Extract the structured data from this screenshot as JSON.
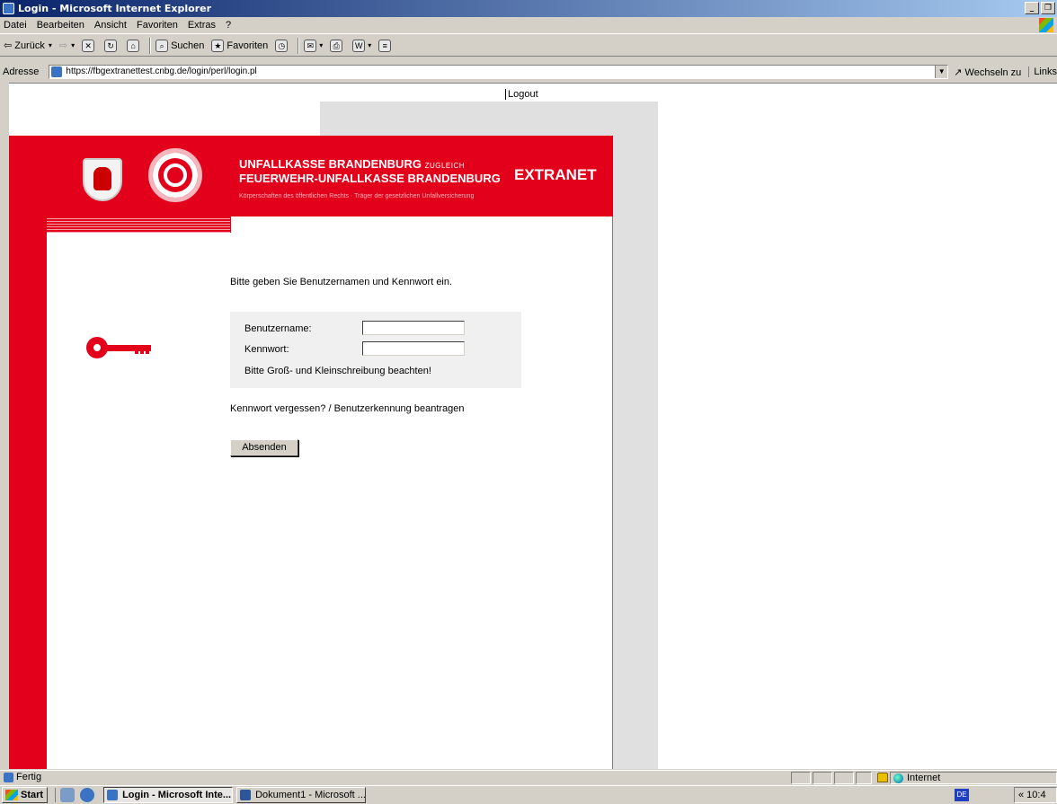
{
  "window": {
    "title": "Login - Microsoft Internet Explorer"
  },
  "menu": [
    "Datei",
    "Bearbeiten",
    "Ansicht",
    "Favoriten",
    "Extras",
    "?"
  ],
  "toolbar": {
    "back_label": "Zurück",
    "search_label": "Suchen",
    "favorites_label": "Favoriten"
  },
  "address": {
    "label": "Adresse",
    "url": "https://fbgextranettest.cnbg.de/login/perl/login.pl",
    "go_label": "Wechseln zu",
    "links_label": "Links"
  },
  "page": {
    "logout": "Logout",
    "banner": {
      "line1": "UNFALLKASSE BRANDENBURG",
      "line1_small": "ZUGLEICH",
      "line2": "FEUERWEHR-UNFALLKASSE BRANDENBURG",
      "extranet": "EXTRANET",
      "subline": "Körperschaften des öffentlichen Rechts · Träger der gesetzlichen Unfallversicherung"
    },
    "intro": "Bitte geben Sie Benutzernamen und Kennwort ein.",
    "form": {
      "username_label": "Benutzername:",
      "username_value": "",
      "password_label": "Kennwort:",
      "password_value": "",
      "hint": "Bitte Groß- und Kleinschreibung beachten!"
    },
    "forgot_link": "Kennwort vergessen? / Benutzerkennung beantragen",
    "submit_label": "Absenden"
  },
  "status": {
    "text": "Fertig",
    "zone": "Internet"
  },
  "taskbar": {
    "start_label": "Start",
    "tasks": [
      "Login - Microsoft Inte...",
      "Dokument1 - Microsoft ..."
    ],
    "lang": "DE",
    "clock": "« 10:4"
  },
  "colors": {
    "brand_red": "#e2001a",
    "window_gray": "#d4d0c8",
    "titlebar_blue": "#0a246a"
  }
}
